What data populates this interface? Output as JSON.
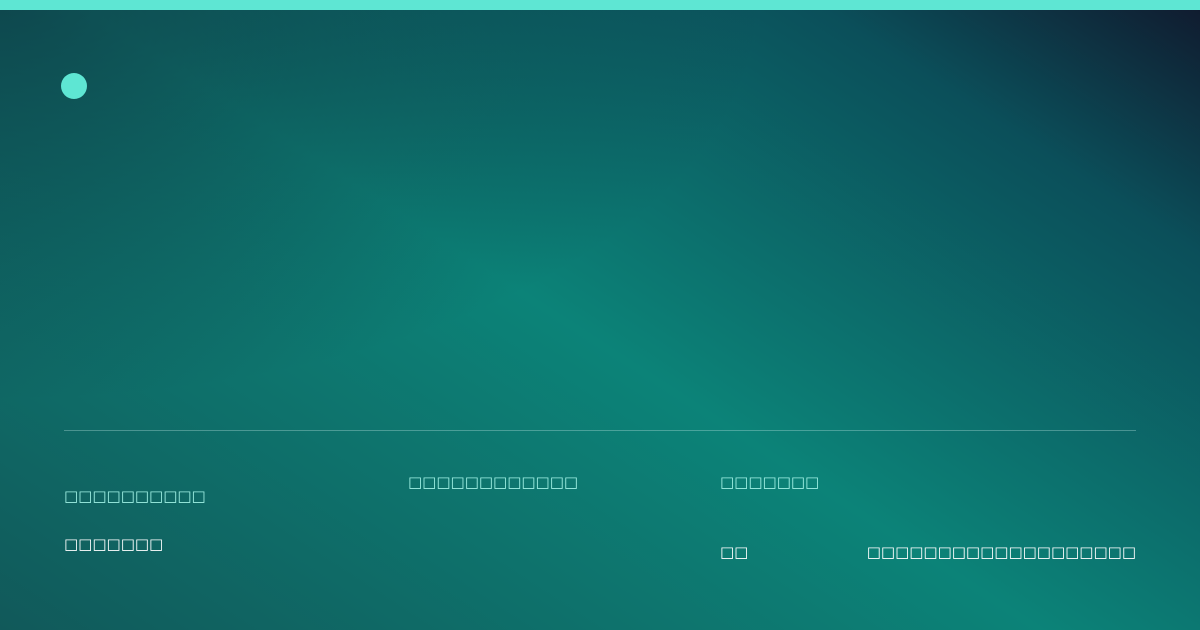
{
  "colors": {
    "accent": "#5ee6d3",
    "background_start": "#101a2e",
    "background_mid": "#0c8378",
    "background_end": "#11595a"
  },
  "footer": {
    "author_name": "□□□□□□□□□□",
    "author_role": "□□□□□□□",
    "date": "□□□□□□□□□□□□",
    "reading_label": "□□□□□□□",
    "reading_value": "□□",
    "site_url": "□□□□□□□□□□□□□□□□□□□"
  }
}
